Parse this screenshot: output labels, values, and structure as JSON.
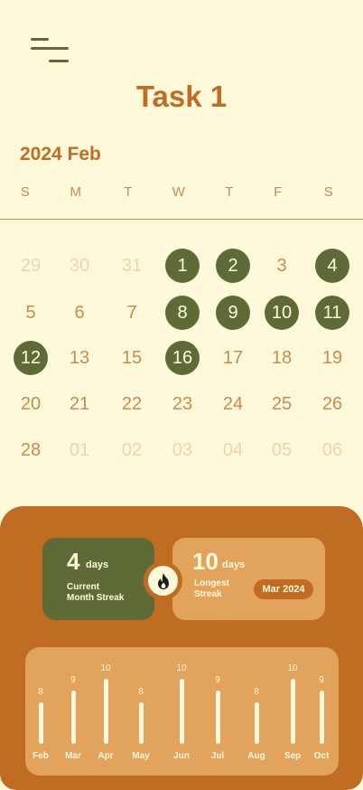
{
  "header": {
    "menu_icon": "menu-icon",
    "title": "Task 1"
  },
  "calendar": {
    "month_label": "2024 Feb",
    "weekdays": [
      "S",
      "M",
      "T",
      "W",
      "T",
      "F",
      "S"
    ],
    "weeks": [
      [
        {
          "d": "29",
          "s": "faded"
        },
        {
          "d": "30",
          "s": "faded"
        },
        {
          "d": "31",
          "s": "faded"
        },
        {
          "d": "1",
          "s": "done"
        },
        {
          "d": "2",
          "s": "done"
        },
        {
          "d": "3",
          "s": "normal"
        },
        {
          "d": "4",
          "s": "done"
        }
      ],
      [
        {
          "d": "5",
          "s": "normal"
        },
        {
          "d": "6",
          "s": "normal"
        },
        {
          "d": "7",
          "s": "normal"
        },
        {
          "d": "8",
          "s": "done"
        },
        {
          "d": "9",
          "s": "done"
        },
        {
          "d": "10",
          "s": "done"
        },
        {
          "d": "11",
          "s": "done"
        }
      ],
      [
        {
          "d": "12",
          "s": "done"
        },
        {
          "d": "13",
          "s": "normal"
        },
        {
          "d": "15",
          "s": "normal"
        },
        {
          "d": "16",
          "s": "done"
        },
        {
          "d": "17",
          "s": "normal"
        },
        {
          "d": "18",
          "s": "normal"
        },
        {
          "d": "19",
          "s": "normal"
        }
      ],
      [
        {
          "d": "20",
          "s": "normal"
        },
        {
          "d": "21",
          "s": "normal"
        },
        {
          "d": "22",
          "s": "normal"
        },
        {
          "d": "23",
          "s": "normal"
        },
        {
          "d": "24",
          "s": "normal"
        },
        {
          "d": "25",
          "s": "normal"
        },
        {
          "d": "26",
          "s": "normal"
        }
      ],
      [
        {
          "d": "28",
          "s": "normal"
        },
        {
          "d": "01",
          "s": "faded"
        },
        {
          "d": "02",
          "s": "faded"
        },
        {
          "d": "03",
          "s": "faded"
        },
        {
          "d": "04",
          "s": "faded"
        },
        {
          "d": "05",
          "s": "faded"
        },
        {
          "d": "06",
          "s": "faded"
        }
      ]
    ]
  },
  "streaks": {
    "current": {
      "value": "4",
      "unit": "days",
      "label_line1": "Current",
      "label_line2": "Month Streak"
    },
    "longest": {
      "value": "10",
      "unit": "days",
      "label_line1": "Longest",
      "label_line2": "Streak",
      "date": "Mar 2024"
    },
    "fire_icon": "fire-icon"
  },
  "chart_data": {
    "type": "bar",
    "categories": [
      "Feb",
      "Mar",
      "Apr",
      "May",
      "Jun",
      "Jul",
      "Aug",
      "Sep",
      "Oct"
    ],
    "values": [
      8,
      9,
      10,
      8,
      10,
      9,
      8,
      10,
      9
    ],
    "ylim": [
      0,
      10
    ]
  },
  "colors": {
    "background": "#fff9dc",
    "accent_orange": "#c06d23",
    "olive": "#5f6b36",
    "light_orange": "#e2a35c",
    "muted_text": "#c98a4c"
  }
}
